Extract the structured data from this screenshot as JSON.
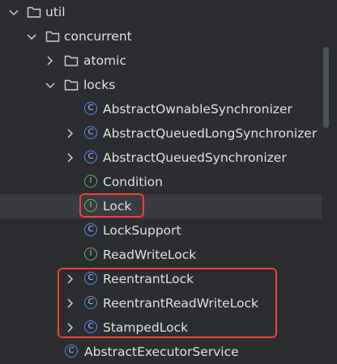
{
  "tree": {
    "util": "util",
    "concurrent": "concurrent",
    "atomic": "atomic",
    "locks": "locks",
    "items": [
      {
        "label": "AbstractOwnableSynchronizer",
        "kind": "class",
        "glyph": "C"
      },
      {
        "label": "AbstractQueuedLongSynchronizer",
        "kind": "class",
        "glyph": "C"
      },
      {
        "label": "AbstractQueuedSynchronizer",
        "kind": "class",
        "glyph": "C"
      },
      {
        "label": "Condition",
        "kind": "interface",
        "glyph": "I"
      },
      {
        "label": "Lock",
        "kind": "interface",
        "glyph": "I"
      },
      {
        "label": "LockSupport",
        "kind": "class",
        "glyph": "C"
      },
      {
        "label": "ReadWriteLock",
        "kind": "interface",
        "glyph": "I"
      },
      {
        "label": "ReentrantLock",
        "kind": "class",
        "glyph": "C"
      },
      {
        "label": "ReentrantReadWriteLock",
        "kind": "class",
        "glyph": "C"
      },
      {
        "label": "StampedLock",
        "kind": "class",
        "glyph": "C"
      }
    ],
    "next_item": {
      "label": "AbstractExecutorService",
      "glyph": "C"
    }
  },
  "colors": {
    "background": "#2b2d30",
    "selection": "#393b40",
    "class_icon": "#548af7",
    "interface_icon": "#5fb865",
    "highlight_box": "#e8433a"
  }
}
